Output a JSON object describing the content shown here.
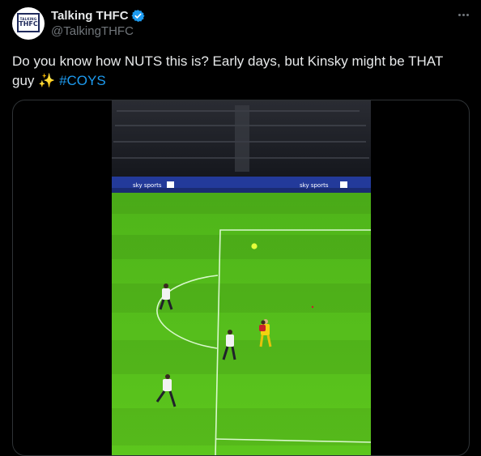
{
  "tweet": {
    "display_name": "Talking THFC",
    "handle": "@TalkingTHFC",
    "verified": true,
    "more_icon": "more-horizontal-icon",
    "avatar": {
      "line1": "TALKING",
      "line2": "THFC"
    },
    "text_main": "Do you know how NUTS this is? Early days, but Kinsky might be THAT guy",
    "emoji": "✨",
    "hashtag": "#COYS"
  },
  "media": {
    "type": "video",
    "board_text": "sky sports",
    "colors": {
      "pitch": "#58c41a",
      "stand": "#1c1f2a",
      "boards": "#233a9a"
    }
  }
}
